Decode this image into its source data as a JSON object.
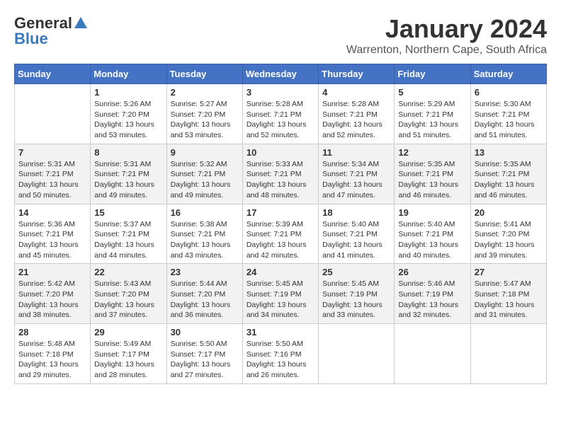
{
  "logo": {
    "general": "General",
    "blue": "Blue"
  },
  "title": "January 2024",
  "subtitle": "Warrenton, Northern Cape, South Africa",
  "days_header": [
    "Sunday",
    "Monday",
    "Tuesday",
    "Wednesday",
    "Thursday",
    "Friday",
    "Saturday"
  ],
  "weeks": [
    [
      {
        "day": "",
        "info": ""
      },
      {
        "day": "1",
        "info": "Sunrise: 5:26 AM\nSunset: 7:20 PM\nDaylight: 13 hours\nand 53 minutes."
      },
      {
        "day": "2",
        "info": "Sunrise: 5:27 AM\nSunset: 7:20 PM\nDaylight: 13 hours\nand 53 minutes."
      },
      {
        "day": "3",
        "info": "Sunrise: 5:28 AM\nSunset: 7:21 PM\nDaylight: 13 hours\nand 52 minutes."
      },
      {
        "day": "4",
        "info": "Sunrise: 5:28 AM\nSunset: 7:21 PM\nDaylight: 13 hours\nand 52 minutes."
      },
      {
        "day": "5",
        "info": "Sunrise: 5:29 AM\nSunset: 7:21 PM\nDaylight: 13 hours\nand 51 minutes."
      },
      {
        "day": "6",
        "info": "Sunrise: 5:30 AM\nSunset: 7:21 PM\nDaylight: 13 hours\nand 51 minutes."
      }
    ],
    [
      {
        "day": "7",
        "info": "Sunrise: 5:31 AM\nSunset: 7:21 PM\nDaylight: 13 hours\nand 50 minutes."
      },
      {
        "day": "8",
        "info": "Sunrise: 5:31 AM\nSunset: 7:21 PM\nDaylight: 13 hours\nand 49 minutes."
      },
      {
        "day": "9",
        "info": "Sunrise: 5:32 AM\nSunset: 7:21 PM\nDaylight: 13 hours\nand 49 minutes."
      },
      {
        "day": "10",
        "info": "Sunrise: 5:33 AM\nSunset: 7:21 PM\nDaylight: 13 hours\nand 48 minutes."
      },
      {
        "day": "11",
        "info": "Sunrise: 5:34 AM\nSunset: 7:21 PM\nDaylight: 13 hours\nand 47 minutes."
      },
      {
        "day": "12",
        "info": "Sunrise: 5:35 AM\nSunset: 7:21 PM\nDaylight: 13 hours\nand 46 minutes."
      },
      {
        "day": "13",
        "info": "Sunrise: 5:35 AM\nSunset: 7:21 PM\nDaylight: 13 hours\nand 46 minutes."
      }
    ],
    [
      {
        "day": "14",
        "info": "Sunrise: 5:36 AM\nSunset: 7:21 PM\nDaylight: 13 hours\nand 45 minutes."
      },
      {
        "day": "15",
        "info": "Sunrise: 5:37 AM\nSunset: 7:21 PM\nDaylight: 13 hours\nand 44 minutes."
      },
      {
        "day": "16",
        "info": "Sunrise: 5:38 AM\nSunset: 7:21 PM\nDaylight: 13 hours\nand 43 minutes."
      },
      {
        "day": "17",
        "info": "Sunrise: 5:39 AM\nSunset: 7:21 PM\nDaylight: 13 hours\nand 42 minutes."
      },
      {
        "day": "18",
        "info": "Sunrise: 5:40 AM\nSunset: 7:21 PM\nDaylight: 13 hours\nand 41 minutes."
      },
      {
        "day": "19",
        "info": "Sunrise: 5:40 AM\nSunset: 7:21 PM\nDaylight: 13 hours\nand 40 minutes."
      },
      {
        "day": "20",
        "info": "Sunrise: 5:41 AM\nSunset: 7:20 PM\nDaylight: 13 hours\nand 39 minutes."
      }
    ],
    [
      {
        "day": "21",
        "info": "Sunrise: 5:42 AM\nSunset: 7:20 PM\nDaylight: 13 hours\nand 38 minutes."
      },
      {
        "day": "22",
        "info": "Sunrise: 5:43 AM\nSunset: 7:20 PM\nDaylight: 13 hours\nand 37 minutes."
      },
      {
        "day": "23",
        "info": "Sunrise: 5:44 AM\nSunset: 7:20 PM\nDaylight: 13 hours\nand 36 minutes."
      },
      {
        "day": "24",
        "info": "Sunrise: 5:45 AM\nSunset: 7:19 PM\nDaylight: 13 hours\nand 34 minutes."
      },
      {
        "day": "25",
        "info": "Sunrise: 5:45 AM\nSunset: 7:19 PM\nDaylight: 13 hours\nand 33 minutes."
      },
      {
        "day": "26",
        "info": "Sunrise: 5:46 AM\nSunset: 7:19 PM\nDaylight: 13 hours\nand 32 minutes."
      },
      {
        "day": "27",
        "info": "Sunrise: 5:47 AM\nSunset: 7:18 PM\nDaylight: 13 hours\nand 31 minutes."
      }
    ],
    [
      {
        "day": "28",
        "info": "Sunrise: 5:48 AM\nSunset: 7:18 PM\nDaylight: 13 hours\nand 29 minutes."
      },
      {
        "day": "29",
        "info": "Sunrise: 5:49 AM\nSunset: 7:17 PM\nDaylight: 13 hours\nand 28 minutes."
      },
      {
        "day": "30",
        "info": "Sunrise: 5:50 AM\nSunset: 7:17 PM\nDaylight: 13 hours\nand 27 minutes."
      },
      {
        "day": "31",
        "info": "Sunrise: 5:50 AM\nSunset: 7:16 PM\nDaylight: 13 hours\nand 26 minutes."
      },
      {
        "day": "",
        "info": ""
      },
      {
        "day": "",
        "info": ""
      },
      {
        "day": "",
        "info": ""
      }
    ]
  ]
}
